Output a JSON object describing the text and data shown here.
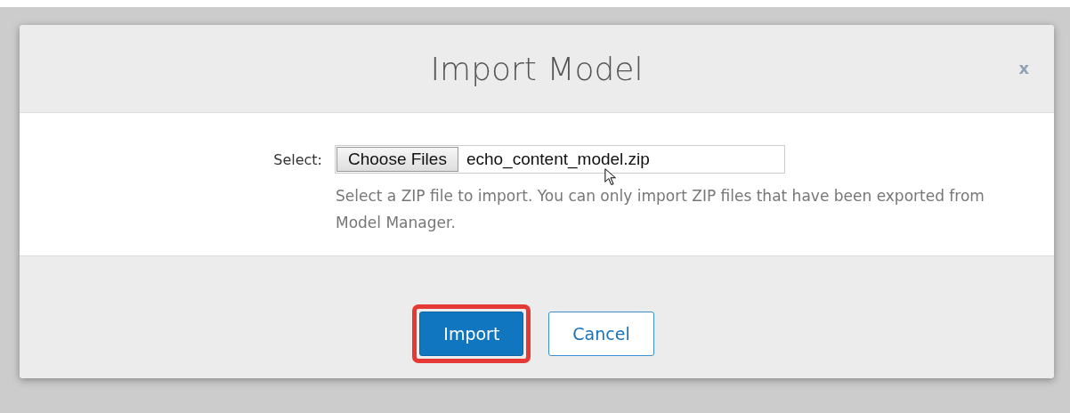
{
  "dialog": {
    "title": "Import Model",
    "close": "x",
    "file_field": {
      "label": "Select:",
      "button": "Choose Files",
      "value": "echo_content_model.zip"
    },
    "hint": "Select a ZIP file to import. You can only import ZIP files that have been exported from Model Manager.",
    "buttons": [
      {
        "label": "Import",
        "kind": "primary",
        "highlighted": true
      },
      {
        "label": "Cancel",
        "kind": "secondary",
        "highlighted": false
      }
    ]
  }
}
